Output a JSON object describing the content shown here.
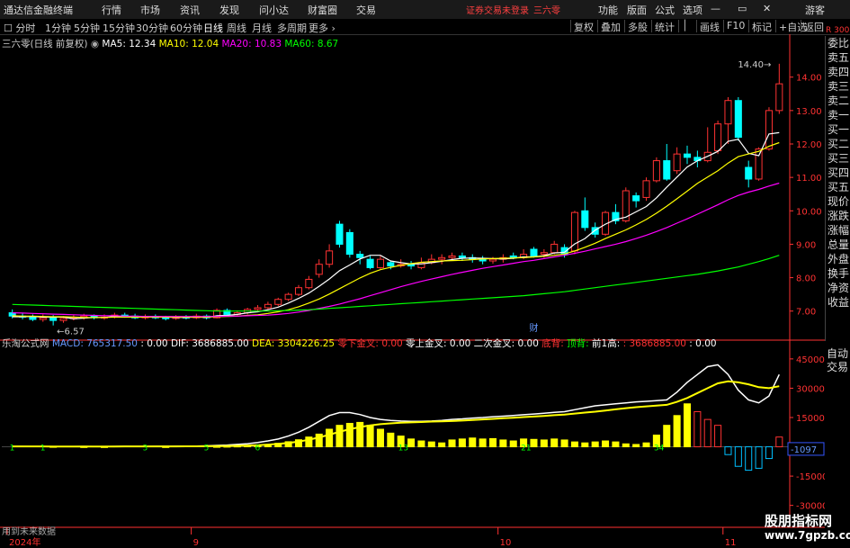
{
  "topbar": {
    "logo": "通达信金融终端",
    "menus": [
      "行情",
      "市场",
      "资讯",
      "发现",
      "问小达",
      "财富圈",
      "交易"
    ],
    "notice": "证券交易未登录",
    "stock_name": "三六零",
    "right": [
      "功能",
      "版面",
      "公式",
      "选项",
      "游客"
    ]
  },
  "periodbar": {
    "periods": [
      "分时",
      "1分钟",
      "5分钟",
      "15分钟",
      "30分钟",
      "60分钟",
      "日线",
      "周线",
      "月线",
      "多周期",
      "更多"
    ],
    "active": "日线",
    "tools": [
      "复权",
      "叠加",
      "多股",
      "统计",
      "画线",
      "F10",
      "标记",
      "+自选",
      "返回"
    ]
  },
  "side": {
    "items": [
      "委比",
      "卖五",
      "卖四",
      "卖三",
      "卖二",
      "卖一",
      "买一",
      "买二",
      "买三",
      "买四",
      "买五",
      "现价",
      "涨跌",
      "涨幅",
      "总量",
      "外盘",
      "换手",
      "净资",
      "收益"
    ],
    "items2": [
      "自动",
      "交易"
    ]
  },
  "main_legend": {
    "title": "三六零(日线 前复权)",
    "ma5": "MA5: 12.34",
    "ma10": "MA10: 12.04",
    "ma20": "MA20: 10.83",
    "ma60": "MA60: 8.67"
  },
  "sub_legend": {
    "name": "乐淘公式网",
    "macd": "MACD: 765317.50",
    "v1": ": 0.00",
    "dif": "DIF: 3686885.00",
    "dea": "DEA: 3304226.25",
    "s1": "零下金叉: 0.00",
    "s2": "零上金叉: 0.00",
    "s3": "二次金叉: 0.00",
    "s4": "底背:",
    "s5": "顶背:",
    "s6": "前1高:",
    "s7": ": 3686885.00",
    "s8": ": 0.00"
  },
  "footer": {
    "nodata": "用到未来数据",
    "watermark": "股朋指标网",
    "watermark2": "www.7gpzb.com",
    "corner": "R 300"
  },
  "colors": {
    "up": "#ff3232",
    "down": "#00ffff",
    "ma5": "#ffffff",
    "ma10": "#ffff00",
    "ma20": "#ff00ff",
    "ma60": "#00ff00",
    "axis": "#ff3232"
  },
  "chart_data": [
    {
      "type": "candlestick",
      "title": "三六零(日线 前复权)",
      "y_ticks": [
        "14.00",
        "13.00",
        "12.00",
        "11.00",
        "10.00",
        "9.00",
        "8.00",
        "7.00"
      ],
      "ylim": [
        6.4,
        14.8
      ],
      "x_ticks": [
        "2024年",
        "9",
        "10",
        "11"
      ],
      "annotations": {
        "high": "14.40",
        "low": "6.57",
        "event": "财"
      },
      "candles": [
        [
          6.95,
          6.85,
          7.05,
          6.78
        ],
        [
          6.85,
          6.82,
          6.95,
          6.75
        ],
        [
          6.82,
          6.75,
          6.9,
          6.7
        ],
        [
          6.75,
          6.8,
          6.9,
          6.68
        ],
        [
          6.8,
          6.72,
          6.88,
          6.57
        ],
        [
          6.72,
          6.78,
          6.85,
          6.65
        ],
        [
          6.78,
          6.8,
          6.88,
          6.72
        ],
        [
          6.8,
          6.85,
          6.92,
          6.74
        ],
        [
          6.85,
          6.8,
          6.9,
          6.75
        ],
        [
          6.8,
          6.82,
          6.9,
          6.74
        ],
        [
          6.82,
          6.88,
          6.95,
          6.78
        ],
        [
          6.88,
          6.85,
          6.95,
          6.8
        ],
        [
          6.85,
          6.8,
          6.92,
          6.76
        ],
        [
          6.8,
          6.84,
          6.9,
          6.75
        ],
        [
          6.84,
          6.8,
          6.9,
          6.76
        ],
        [
          6.8,
          6.78,
          6.86,
          6.72
        ],
        [
          6.78,
          6.82,
          6.88,
          6.74
        ],
        [
          6.82,
          6.8,
          6.88,
          6.75
        ],
        [
          6.8,
          6.85,
          6.92,
          6.76
        ],
        [
          6.85,
          6.8,
          6.9,
          6.75
        ],
        [
          6.8,
          7.02,
          7.08,
          6.78
        ],
        [
          7.02,
          6.9,
          7.08,
          6.85
        ],
        [
          6.9,
          6.95,
          7.02,
          6.85
        ],
        [
          6.95,
          7.05,
          7.1,
          6.9
        ],
        [
          7.05,
          7.1,
          7.18,
          7.0
        ],
        [
          7.1,
          7.2,
          7.28,
          7.05
        ],
        [
          7.2,
          7.35,
          7.4,
          7.15
        ],
        [
          7.35,
          7.5,
          7.55,
          7.3
        ],
        [
          7.5,
          7.7,
          7.78,
          7.45
        ],
        [
          7.7,
          7.95,
          8.05,
          7.65
        ],
        [
          8.1,
          8.4,
          8.55,
          8.0
        ],
        [
          8.4,
          8.8,
          9.0,
          8.3
        ],
        [
          9.6,
          9.0,
          9.7,
          8.9
        ],
        [
          9.35,
          8.7,
          9.45,
          8.6
        ],
        [
          8.7,
          8.6,
          8.8,
          8.4
        ],
        [
          8.55,
          8.3,
          8.65,
          8.25
        ],
        [
          8.3,
          8.55,
          8.65,
          8.25
        ],
        [
          8.45,
          8.35,
          8.5,
          8.25
        ],
        [
          8.35,
          8.4,
          8.55,
          8.3
        ],
        [
          8.4,
          8.35,
          8.5,
          8.25
        ],
        [
          8.3,
          8.45,
          8.6,
          8.25
        ],
        [
          8.45,
          8.55,
          8.7,
          8.4
        ],
        [
          8.55,
          8.6,
          8.7,
          8.4
        ],
        [
          8.6,
          8.65,
          8.75,
          8.5
        ],
        [
          8.65,
          8.6,
          8.75,
          8.5
        ],
        [
          8.6,
          8.55,
          8.7,
          8.45
        ],
        [
          8.55,
          8.5,
          8.65,
          8.4
        ],
        [
          8.5,
          8.55,
          8.62,
          8.42
        ],
        [
          8.55,
          8.6,
          8.7,
          8.45
        ],
        [
          8.65,
          8.6,
          8.75,
          8.55
        ],
        [
          8.6,
          8.7,
          8.85,
          8.55
        ],
        [
          8.85,
          8.65,
          8.92,
          8.6
        ],
        [
          8.7,
          8.75,
          8.85,
          8.6
        ],
        [
          8.75,
          9.0,
          9.1,
          8.7
        ],
        [
          8.9,
          8.7,
          9.0,
          8.6
        ],
        [
          8.8,
          9.95,
          10.0,
          8.7
        ],
        [
          10.0,
          9.5,
          10.4,
          9.4
        ],
        [
          9.5,
          9.3,
          9.65,
          9.2
        ],
        [
          9.3,
          9.95,
          10.0,
          9.25
        ],
        [
          9.95,
          9.7,
          10.2,
          9.6
        ],
        [
          9.7,
          10.6,
          10.7,
          9.65
        ],
        [
          10.45,
          10.3,
          10.55,
          10.1
        ],
        [
          10.4,
          10.9,
          11.0,
          10.3
        ],
        [
          10.9,
          11.5,
          11.6,
          10.85
        ],
        [
          11.5,
          10.95,
          12.0,
          10.9
        ],
        [
          11.2,
          11.7,
          11.9,
          11.1
        ],
        [
          11.7,
          11.6,
          11.95,
          11.4
        ],
        [
          11.6,
          11.5,
          11.8,
          11.3
        ],
        [
          11.5,
          11.75,
          12.5,
          11.45
        ],
        [
          11.8,
          12.6,
          12.7,
          11.7
        ],
        [
          12.6,
          13.3,
          13.4,
          12.0
        ],
        [
          13.3,
          12.2,
          13.4,
          12.1
        ],
        [
          11.3,
          10.95,
          11.5,
          10.7
        ],
        [
          10.95,
          11.85,
          11.9,
          10.9
        ],
        [
          11.85,
          13.0,
          13.1,
          11.8
        ],
        [
          13.0,
          13.8,
          14.4,
          12.9
        ]
      ],
      "series": [
        {
          "name": "MA5",
          "values": [
            6.83,
            6.83,
            6.84,
            6.82,
            6.82,
            6.82,
            6.77,
            6.79,
            6.81,
            6.81,
            6.84,
            6.84,
            6.83,
            6.83,
            6.84,
            6.82,
            6.81,
            6.81,
            6.82,
            6.81,
            6.86,
            6.87,
            6.9,
            6.95,
            6.98,
            7.04,
            7.12,
            7.24,
            7.38,
            7.54,
            7.74,
            7.96,
            8.21,
            8.38,
            8.56,
            8.67,
            8.67,
            8.5,
            8.45,
            8.41,
            8.41,
            8.45,
            8.49,
            8.54,
            8.58,
            8.59,
            8.58,
            8.57,
            8.56,
            8.58,
            8.62,
            8.62,
            8.66,
            8.74,
            8.76,
            9.01,
            9.17,
            9.42,
            9.6,
            9.74,
            9.81,
            9.97,
            10.13,
            10.39,
            10.71,
            11.01,
            11.31,
            11.5,
            11.63,
            11.78,
            12.08,
            12.14,
            11.72,
            11.65,
            12.3,
            12.34
          ]
        },
        {
          "name": "MA10",
          "values": [
            6.86,
            6.85,
            6.85,
            6.84,
            6.83,
            6.83,
            6.82,
            6.81,
            6.81,
            6.81,
            6.82,
            6.82,
            6.82,
            6.82,
            6.82,
            6.82,
            6.82,
            6.82,
            6.82,
            6.82,
            6.83,
            6.84,
            6.85,
            6.87,
            6.89,
            6.93,
            6.98,
            7.04,
            7.13,
            7.24,
            7.36,
            7.51,
            7.67,
            7.83,
            7.99,
            8.13,
            8.24,
            8.31,
            8.37,
            8.42,
            8.46,
            8.48,
            8.5,
            8.51,
            8.52,
            8.54,
            8.56,
            8.57,
            8.58,
            8.59,
            8.6,
            8.62,
            8.64,
            8.67,
            8.71,
            8.8,
            8.91,
            9.03,
            9.17,
            9.3,
            9.43,
            9.58,
            9.74,
            9.93,
            10.14,
            10.36,
            10.59,
            10.82,
            11.01,
            11.2,
            11.43,
            11.62,
            11.7,
            11.78,
            11.93,
            12.04
          ]
        },
        {
          "name": "MA20",
          "values": [
            6.95,
            6.94,
            6.93,
            6.92,
            6.91,
            6.9,
            6.89,
            6.88,
            6.87,
            6.86,
            6.86,
            6.85,
            6.85,
            6.84,
            6.84,
            6.84,
            6.84,
            6.84,
            6.84,
            6.84,
            6.84,
            6.85,
            6.85,
            6.86,
            6.87,
            6.88,
            6.9,
            6.93,
            6.97,
            7.02,
            7.08,
            7.14,
            7.21,
            7.29,
            7.37,
            7.46,
            7.55,
            7.64,
            7.73,
            7.81,
            7.89,
            7.96,
            8.03,
            8.1,
            8.16,
            8.22,
            8.28,
            8.33,
            8.38,
            8.43,
            8.48,
            8.52,
            8.57,
            8.62,
            8.67,
            8.73,
            8.79,
            8.86,
            8.93,
            9.0,
            9.08,
            9.17,
            9.27,
            9.38,
            9.5,
            9.63,
            9.76,
            9.9,
            10.04,
            10.18,
            10.33,
            10.46,
            10.56,
            10.64,
            10.74,
            10.83
          ]
        },
        {
          "name": "MA60",
          "values": [
            7.2,
            7.19,
            7.18,
            7.17,
            7.16,
            7.15,
            7.14,
            7.13,
            7.12,
            7.11,
            7.1,
            7.09,
            7.08,
            7.07,
            7.06,
            7.05,
            7.04,
            7.03,
            7.02,
            7.01,
            7.0,
            7.0,
            7.0,
            7.0,
            7.0,
            7.0,
            7.01,
            7.02,
            7.03,
            7.04,
            7.06,
            7.08,
            7.1,
            7.12,
            7.14,
            7.16,
            7.18,
            7.2,
            7.22,
            7.24,
            7.26,
            7.28,
            7.3,
            7.32,
            7.34,
            7.36,
            7.38,
            7.4,
            7.42,
            7.44,
            7.46,
            7.49,
            7.52,
            7.55,
            7.58,
            7.62,
            7.66,
            7.7,
            7.74,
            7.78,
            7.82,
            7.86,
            7.9,
            7.94,
            7.98,
            8.02,
            8.06,
            8.1,
            8.15,
            8.2,
            8.26,
            8.32,
            8.4,
            8.48,
            8.57,
            8.67
          ]
        }
      ]
    },
    {
      "type": "bar",
      "title": "乐淘公式网",
      "y_ticks": [
        "45000",
        "30000",
        "15000",
        "0",
        "-15000",
        "-30000"
      ],
      "ylim": [
        -32000,
        50000
      ],
      "bar_labels": {
        "0": "1",
        "3": "1",
        "13": "3",
        "19": "5",
        "24": "6",
        "38": "13",
        "50": "21",
        "63": "34"
      },
      "macd": [
        0,
        0,
        0,
        0,
        200,
        0,
        0,
        100,
        0,
        100,
        0,
        0,
        0,
        0,
        0,
        100,
        0,
        0,
        0,
        0,
        200,
        300,
        400,
        500,
        800,
        1200,
        1800,
        2600,
        3600,
        5000,
        6500,
        9000,
        11000,
        12000,
        12500,
        11000,
        9000,
        7000,
        5500,
        4000,
        3000,
        2500,
        2000,
        3500,
        4000,
        4500,
        4000,
        4200,
        3500,
        3000,
        4000,
        3800,
        3500,
        4000,
        3500,
        2500,
        2000,
        2500,
        3000,
        2500,
        1500,
        1200,
        2000,
        6000,
        11000,
        16000,
        22000,
        18000,
        14000,
        11000,
        -4000,
        -10000,
        -12000,
        -11000,
        -6000,
        5000
      ],
      "series": [
        {
          "name": "DIF",
          "values": [
            200,
            200,
            150,
            150,
            100,
            100,
            150,
            200,
            150,
            150,
            200,
            250,
            200,
            200,
            250,
            250,
            300,
            350,
            400,
            500,
            700,
            900,
            1200,
            1600,
            2200,
            3000,
            4000,
            5500,
            7500,
            10000,
            13000,
            16000,
            17500,
            17500,
            16500,
            15000,
            14000,
            13500,
            13200,
            13000,
            13000,
            13200,
            13500,
            14000,
            14300,
            14700,
            15000,
            15400,
            15700,
            16000,
            16400,
            16800,
            17200,
            17600,
            18000,
            19000,
            20000,
            21000,
            21500,
            22000,
            22500,
            23000,
            23300,
            23600,
            24000,
            28000,
            33000,
            37000,
            41000,
            42000,
            37000,
            29000,
            24000,
            22500,
            26000,
            37000
          ]
        },
        {
          "name": "DEA",
          "values": [
            200,
            200,
            200,
            180,
            170,
            160,
            160,
            170,
            170,
            165,
            170,
            180,
            185,
            190,
            200,
            210,
            220,
            240,
            260,
            290,
            350,
            420,
            520,
            650,
            840,
            1100,
            1500,
            2000,
            2700,
            3600,
            4800,
            6200,
            7700,
            9000,
            10100,
            11000,
            11600,
            12000,
            12300,
            12500,
            12700,
            12900,
            13000,
            13200,
            13400,
            13700,
            14000,
            14300,
            14600,
            14900,
            15200,
            15500,
            15800,
            16200,
            16500,
            17000,
            17500,
            18000,
            18600,
            19200,
            19800,
            20300,
            20700,
            21100,
            21500,
            23000,
            25000,
            27500,
            30000,
            32500,
            33500,
            33000,
            32000,
            30500,
            30000,
            31000
          ]
        }
      ]
    }
  ]
}
